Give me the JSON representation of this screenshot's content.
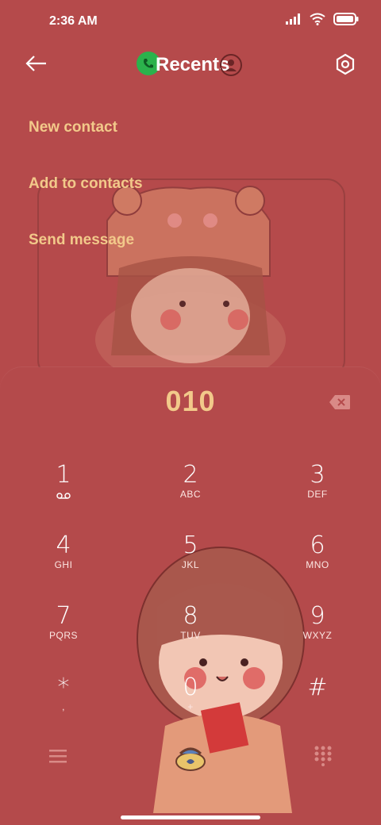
{
  "status_bar": {
    "time": "2:36 AM"
  },
  "header": {
    "title": "Recents"
  },
  "menu": {
    "items": [
      {
        "label": "New contact"
      },
      {
        "label": "Add to contacts"
      },
      {
        "label": "Send message"
      }
    ]
  },
  "dialer": {
    "number": "010",
    "keys": [
      {
        "digit": "1",
        "letters": ""
      },
      {
        "digit": "2",
        "letters": "ABC"
      },
      {
        "digit": "3",
        "letters": "DEF"
      },
      {
        "digit": "4",
        "letters": "GHI"
      },
      {
        "digit": "5",
        "letters": "JKL"
      },
      {
        "digit": "6",
        "letters": "MNO"
      },
      {
        "digit": "7",
        "letters": "PQRS"
      },
      {
        "digit": "8",
        "letters": "TUV"
      },
      {
        "digit": "9",
        "letters": "WXYZ"
      },
      {
        "digit": "*",
        "letters": ","
      },
      {
        "digit": "0",
        "letters": "+"
      },
      {
        "digit": "#",
        "letters": ""
      }
    ]
  },
  "colors": {
    "background": "#b54a4b",
    "accent": "#f2c98a",
    "call_green": "#2bb24c"
  },
  "icons": [
    "back-arrow-icon",
    "phone-icon",
    "contact-icon",
    "settings-icon",
    "backspace-icon",
    "voicemail-icon",
    "menu-icon",
    "call-icon",
    "dialpad-icon"
  ]
}
